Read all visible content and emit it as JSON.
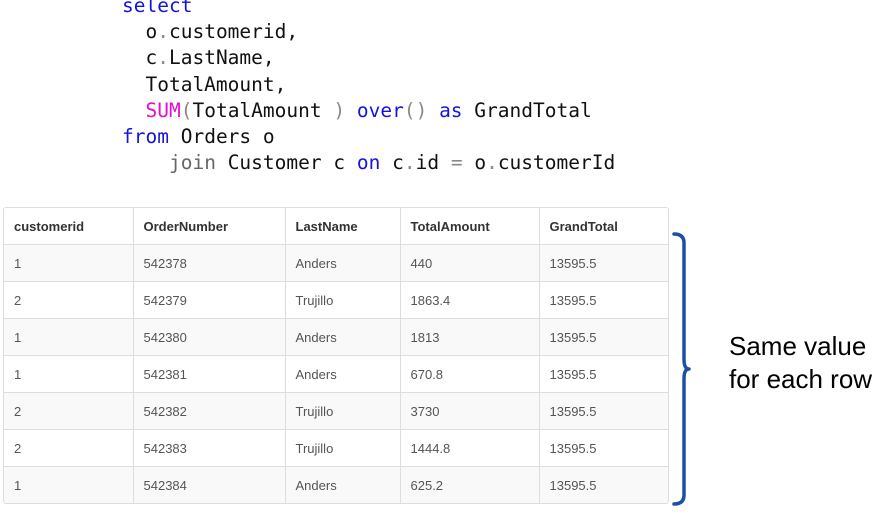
{
  "sql": {
    "kw_select": "select",
    "l1_alias": "o",
    "l1_dot": ".",
    "l1_col": "customerid,",
    "l2_alias": "c",
    "l2_dot": ".",
    "l2_col": "LastName,",
    "l3": "TotalAmount,",
    "l4_fn": "SUM",
    "l4_open": "(",
    "l4_arg": "TotalAmount ",
    "l4_close": ")",
    "l4_over": "over",
    "l4_parens": "()",
    "l4_as": "as",
    "l4_alias": "GrandTotal",
    "kw_from": "from",
    "l5_rest": "Orders o",
    "l6_join": "join",
    "l6_table": "Customer c",
    "l6_on": "on",
    "l6_c": "c",
    "l6_dot1": ".",
    "l6_id": "id",
    "l6_eq": "=",
    "l6_o": "o",
    "l6_dot2": ".",
    "l6_cid": "customerId"
  },
  "table": {
    "headers": [
      "customerid",
      "OrderNumber",
      "LastName",
      "TotalAmount",
      "GrandTotal"
    ],
    "rows": [
      [
        "1",
        "542378",
        "Anders",
        "440",
        "13595.5"
      ],
      [
        "2",
        "542379",
        "Trujillo",
        "1863.4",
        "13595.5"
      ],
      [
        "1",
        "542380",
        "Anders",
        "1813",
        "13595.5"
      ],
      [
        "1",
        "542381",
        "Anders",
        "670.8",
        "13595.5"
      ],
      [
        "2",
        "542382",
        "Trujillo",
        "3730",
        "13595.5"
      ],
      [
        "2",
        "542383",
        "Trujillo",
        "1444.8",
        "13595.5"
      ],
      [
        "1",
        "542384",
        "Anders",
        "625.2",
        "13595.5"
      ]
    ]
  },
  "annotation": {
    "line1": "Same value",
    "line2": "for each row",
    "bracket_color": "#1f4ea6"
  }
}
